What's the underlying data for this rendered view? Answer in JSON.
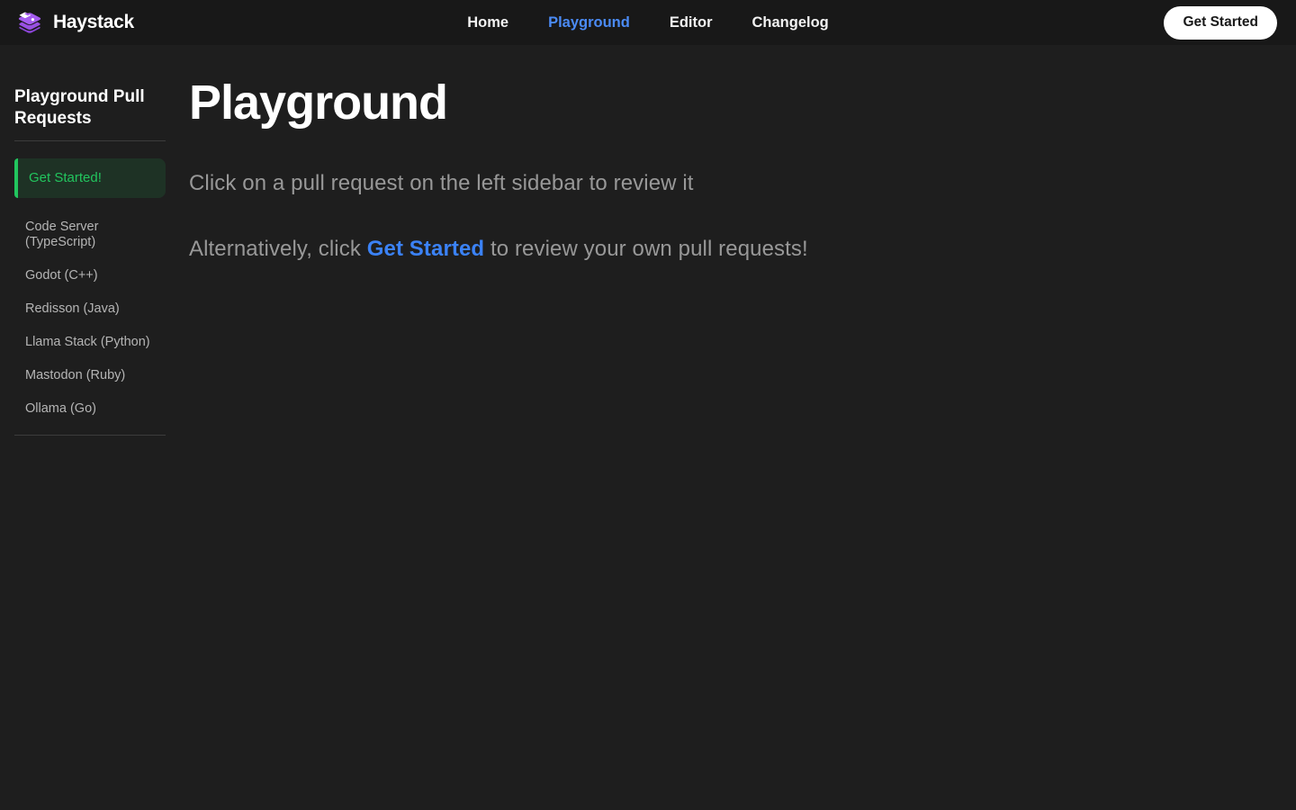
{
  "brand": {
    "name": "Haystack"
  },
  "nav": {
    "items": [
      {
        "label": "Home",
        "active": false
      },
      {
        "label": "Playground",
        "active": true
      },
      {
        "label": "Editor",
        "active": false
      },
      {
        "label": "Changelog",
        "active": false
      }
    ],
    "cta_label": "Get Started"
  },
  "sidebar": {
    "title": "Playground Pull Requests",
    "items": [
      {
        "label": "Get Started!",
        "active": true
      },
      {
        "label": "Code Server (TypeScript)",
        "active": false
      },
      {
        "label": "Godot (C++)",
        "active": false
      },
      {
        "label": "Redisson (Java)",
        "active": false
      },
      {
        "label": "Llama Stack (Python)",
        "active": false
      },
      {
        "label": "Mastodon (Ruby)",
        "active": false
      },
      {
        "label": "Ollama (Go)",
        "active": false
      }
    ]
  },
  "main": {
    "title": "Playground",
    "line1": "Click on a pull request on the left sidebar to review it",
    "line2_prefix": "Alternatively, click",
    "line2_link": "Get Started",
    "line2_suffix": "to review your own pull requests!"
  },
  "colors": {
    "accent_purple": "#a55cf0",
    "accent_blue": "#3b82f6",
    "nav_active_blue": "#4b8bf5",
    "accent_green": "#22c55e",
    "topbar_bg": "#181818",
    "page_bg": "#1e1e1e"
  }
}
